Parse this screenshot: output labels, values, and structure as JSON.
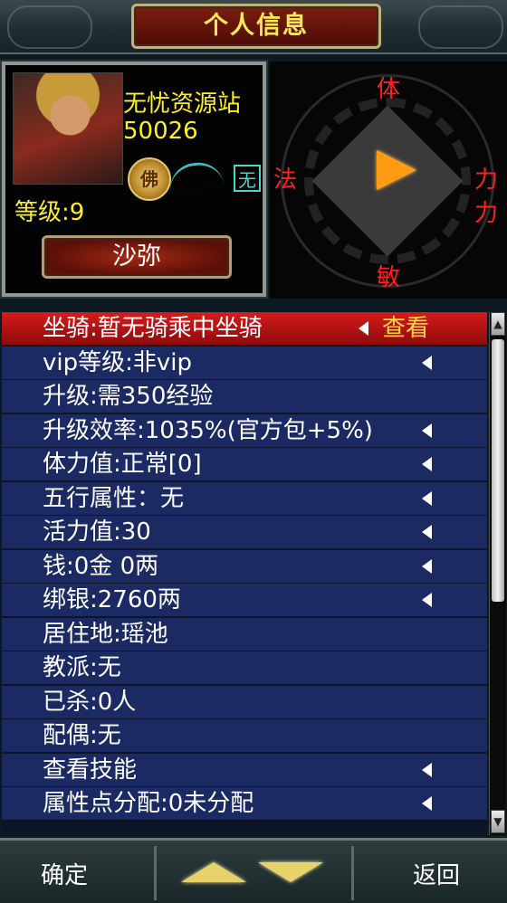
{
  "header": {
    "title": "个人信息"
  },
  "player": {
    "name": "无忧资源站",
    "id": "50026",
    "badge": "佛",
    "tag": "无",
    "level": "等级:9",
    "rank": "沙弥"
  },
  "compass": {
    "top": "体",
    "left": "法",
    "right": "力力",
    "bottom": "敏",
    "pointer_color": "#ff9a12"
  },
  "rows": [
    {
      "text": "坐骑:暂无骑乘中坐骑",
      "action": "查看"
    },
    {
      "text": "vip等级:非vip"
    },
    {
      "text": "升级:需350经验"
    },
    {
      "text": "升级效率:1035%(官方包+5%)"
    },
    {
      "text": "体力值:正常[0]"
    },
    {
      "text": "五行属性：无"
    },
    {
      "text": "活力值:30"
    },
    {
      "text": "钱:0金 0两"
    },
    {
      "text": "绑银:2760两"
    },
    {
      "text": "居住地:瑶池"
    },
    {
      "text": "教派:无"
    },
    {
      "text": "已杀:0人"
    },
    {
      "text": "配偶:无"
    },
    {
      "text": "查看技能"
    },
    {
      "text": "属性点分配:0未分配"
    }
  ],
  "footer": {
    "confirm": "确定",
    "back": "返回"
  },
  "colors": {
    "row_bg": "#1b2a63",
    "row_selected": "#d61c1c",
    "accent_yellow": "#ffee2a",
    "direction_red": "#ff2020"
  }
}
